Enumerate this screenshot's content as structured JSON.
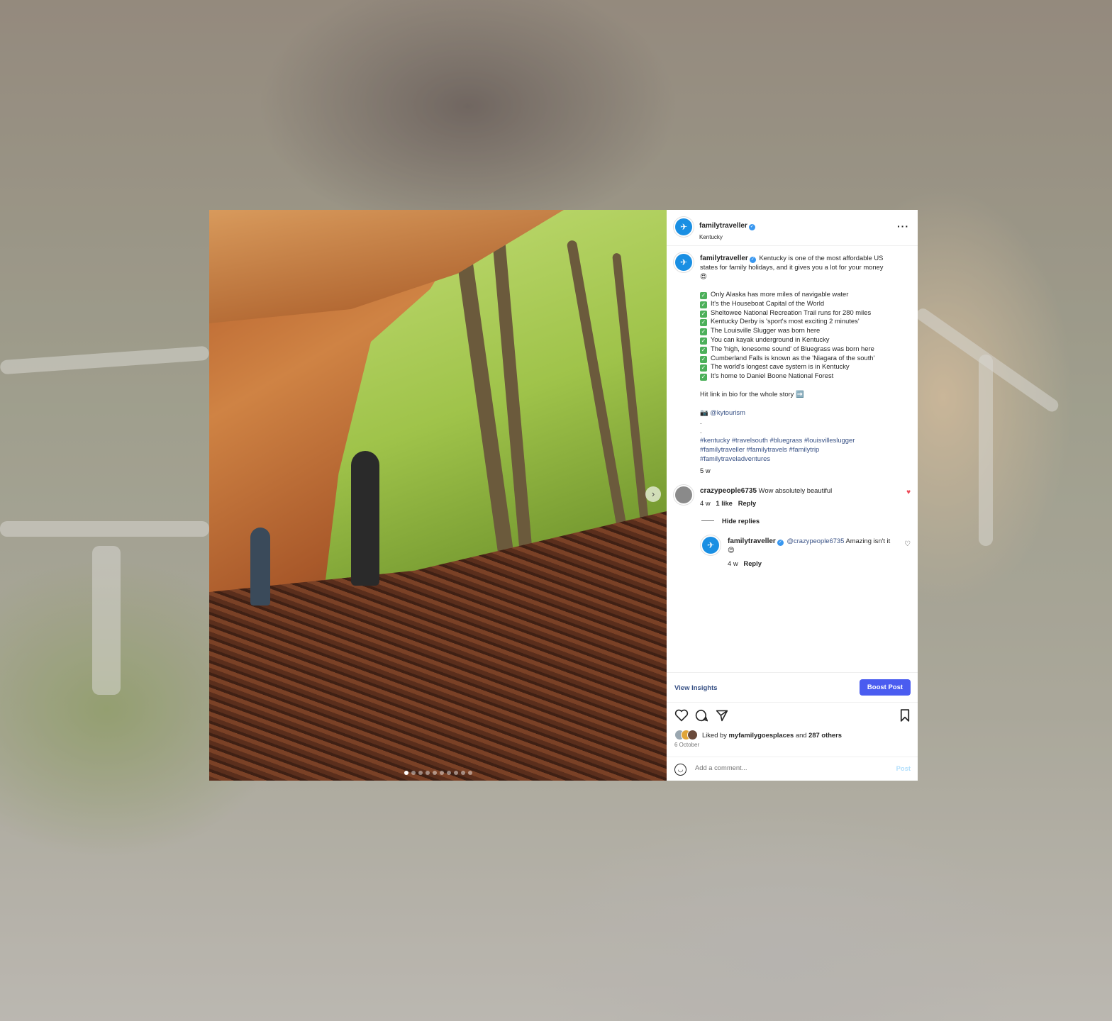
{
  "post": {
    "username": "familytraveller",
    "location": "Kentucky",
    "more_icon": "more-horizontal-icon",
    "caption_intro": "Kentucky is one of the most affordable US",
    "caption_intro2": "states for family holidays, and it gives you a lot for your money",
    "caption_emoji": "😍",
    "facts": [
      "Only Alaska has more miles of navigable water",
      "It's the Houseboat Capital of the World",
      "Sheltowee National Recreation Trail runs for 280 miles",
      "Kentucky Derby is 'sport's most exciting 2 minutes'",
      "The Louisville Slugger was born here",
      "You can kayak underground in Kentucky",
      "The 'high, lonesome sound' of Bluegrass was born here",
      "Cumberland Falls is known as the 'Niagara of the south'",
      "The world's longest cave system is in Kentucky",
      "It's home to Daniel Boone National Forest"
    ],
    "link_line": "Hit link in bio for the whole story ➡️",
    "credit_emoji": "📷",
    "credit_handle": "@kytourism",
    "dot1": ".",
    "dot2": ".",
    "hashtags_line1": "#kentucky #travelsouth #bluegrass #louisvilleslugger",
    "hashtags_line2": "#familytraveller #familytravels #familytrip",
    "hashtags_line3": "#familytraveladventures",
    "caption_time": "5 w"
  },
  "comments": [
    {
      "username": "crazypeople6735",
      "text": "Wow absolutely beautiful",
      "time": "4 w",
      "likes": "1 like",
      "reply": "Reply",
      "liked": true
    }
  ],
  "hide_replies": "Hide replies",
  "reply": {
    "username": "familytraveller",
    "mention": "@crazypeople6735",
    "text": "Amazing isn't it",
    "emoji": "😍",
    "time": "4 w",
    "reply": "Reply"
  },
  "insights": {
    "view": "View Insights",
    "boost": "Boost Post"
  },
  "actions": [
    "heart-icon",
    "comment-icon",
    "share-icon",
    "bookmark-icon"
  ],
  "likes": {
    "prefix": "Liked by ",
    "user": "myfamilygoesplaces",
    "suffix": " and ",
    "others": "287 others"
  },
  "date": "6 October",
  "comment_box": {
    "placeholder": "Add a comment...",
    "post": "Post"
  },
  "carousel": {
    "count": 10,
    "active": 0
  },
  "colors": {
    "accent": "#4a5cf0",
    "link": "#385185",
    "like_red": "#ed4956",
    "verified": "#3897f0"
  }
}
